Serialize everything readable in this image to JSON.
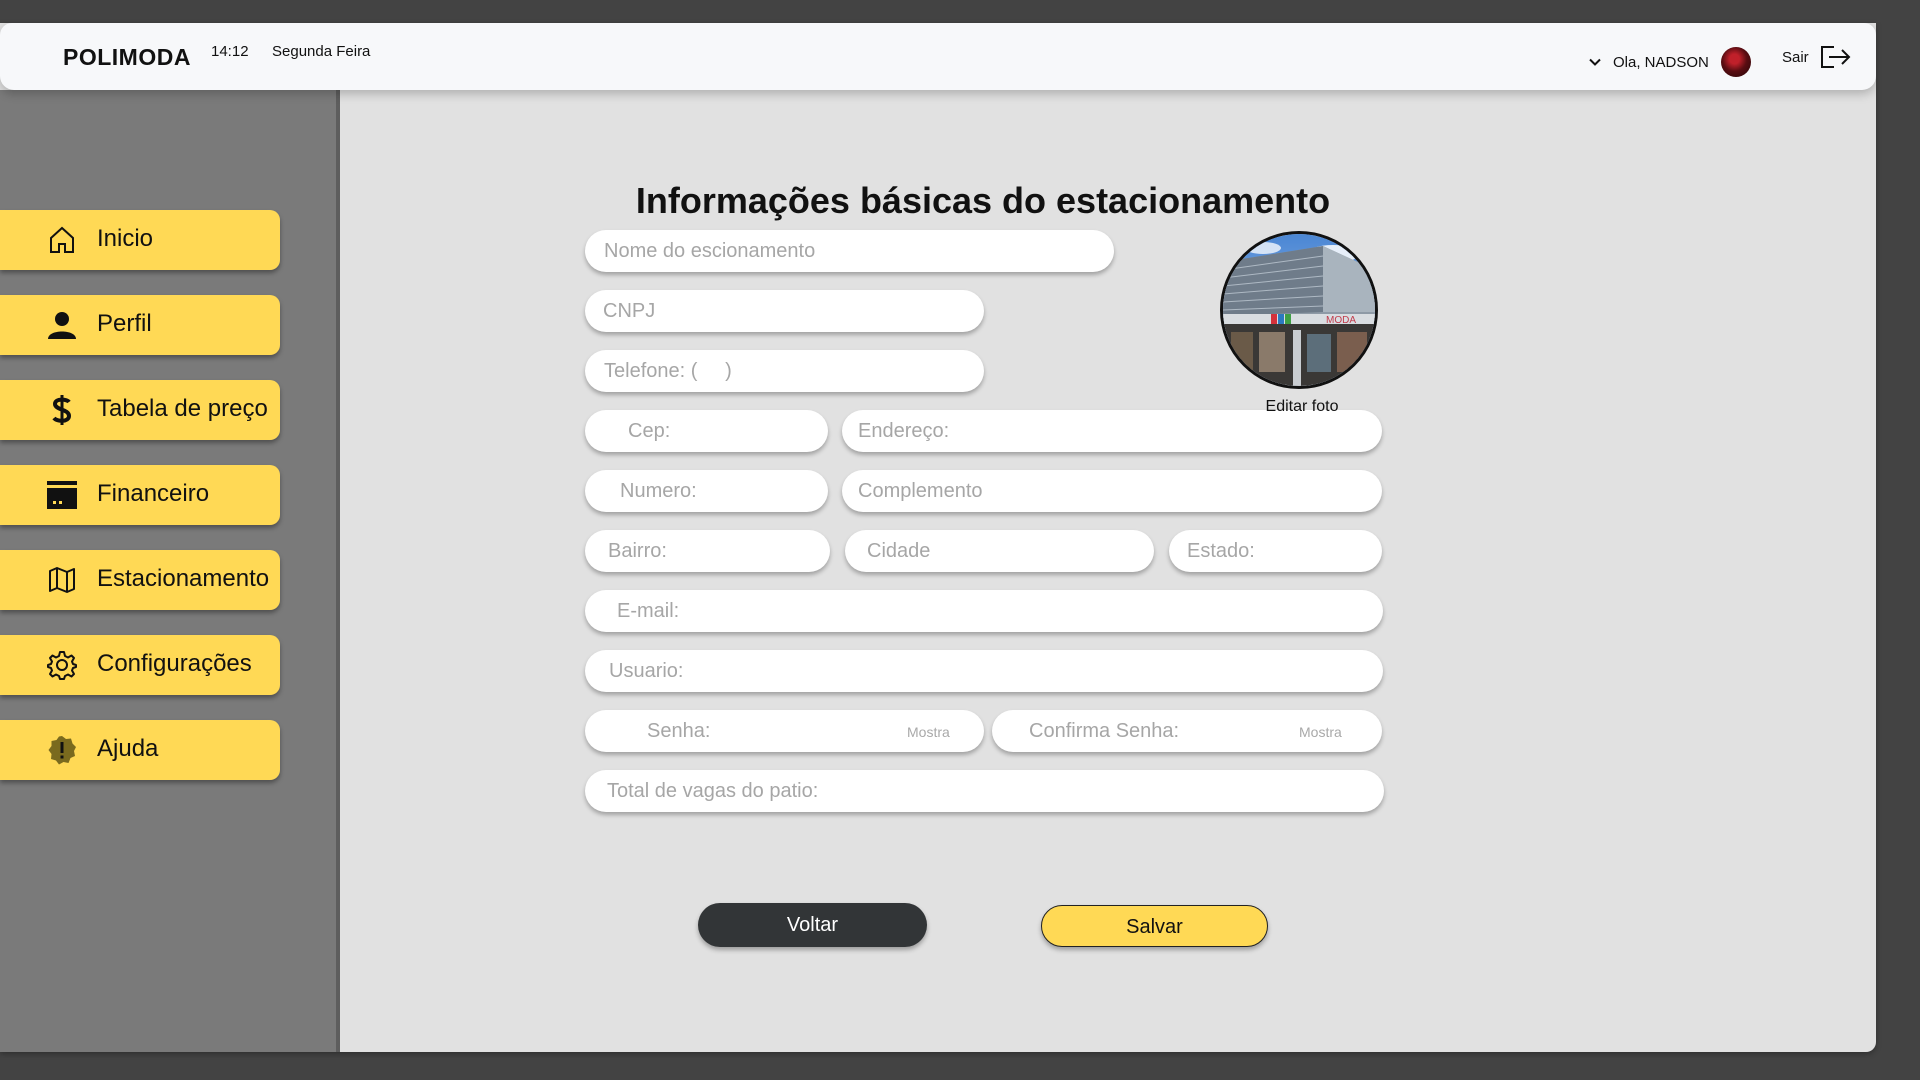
{
  "header": {
    "brand": "POLIMODA",
    "time": "14:12",
    "day": "Segunda Feira",
    "greeting": "Ola, NADSON",
    "logout_label": "Sair"
  },
  "sidebar": {
    "items": [
      {
        "label": "Inicio",
        "icon": "home-icon"
      },
      {
        "label": "Perfil",
        "icon": "user-icon"
      },
      {
        "label": "Tabela de preço",
        "icon": "dollar-icon"
      },
      {
        "label": "Financeiro",
        "icon": "finance-icon"
      },
      {
        "label": "Estacionamento",
        "icon": "map-icon"
      },
      {
        "label": "Configurações",
        "icon": "gear-icon"
      },
      {
        "label": "Ajuda",
        "icon": "alert-badge-icon"
      }
    ]
  },
  "form": {
    "title": "Informações básicas do estacionamento",
    "nome": {
      "placeholder": "Nome do escionamento",
      "value": ""
    },
    "cnpj": {
      "placeholder": "CNPJ",
      "value": ""
    },
    "telefone": {
      "placeholder": "Telefone: (     )",
      "value": ""
    },
    "cep": {
      "placeholder": "Cep:",
      "value": ""
    },
    "endereco": {
      "placeholder": "Endereço:",
      "value": ""
    },
    "numero": {
      "placeholder": "Numero:",
      "value": ""
    },
    "complemento": {
      "placeholder": "Complemento",
      "value": ""
    },
    "bairro": {
      "placeholder": "Bairro:",
      "value": ""
    },
    "cidade": {
      "placeholder": "Cidade",
      "value": ""
    },
    "estado": {
      "placeholder": "Estado:",
      "value": ""
    },
    "email": {
      "placeholder": "E-mail:",
      "value": ""
    },
    "usuario": {
      "placeholder": "Usuario:",
      "value": ""
    },
    "senha": {
      "placeholder": "Senha:",
      "value": "",
      "toggle_label": "Mostra"
    },
    "confirma_senha": {
      "placeholder": "Confirma Senha:",
      "value": "",
      "toggle_label": "Mostra"
    },
    "total_vagas": {
      "placeholder": "Total de vagas do patio:",
      "value": ""
    },
    "edit_photo_label": "Editar foto",
    "photo_sign": "MODA",
    "back_label": "Voltar",
    "save_label": "Salvar"
  },
  "colors": {
    "accent_yellow": "#ffd955",
    "dark_button": "#323537",
    "sidebar_bg": "#7a7a7a",
    "content_bg": "#e1e1e1"
  }
}
